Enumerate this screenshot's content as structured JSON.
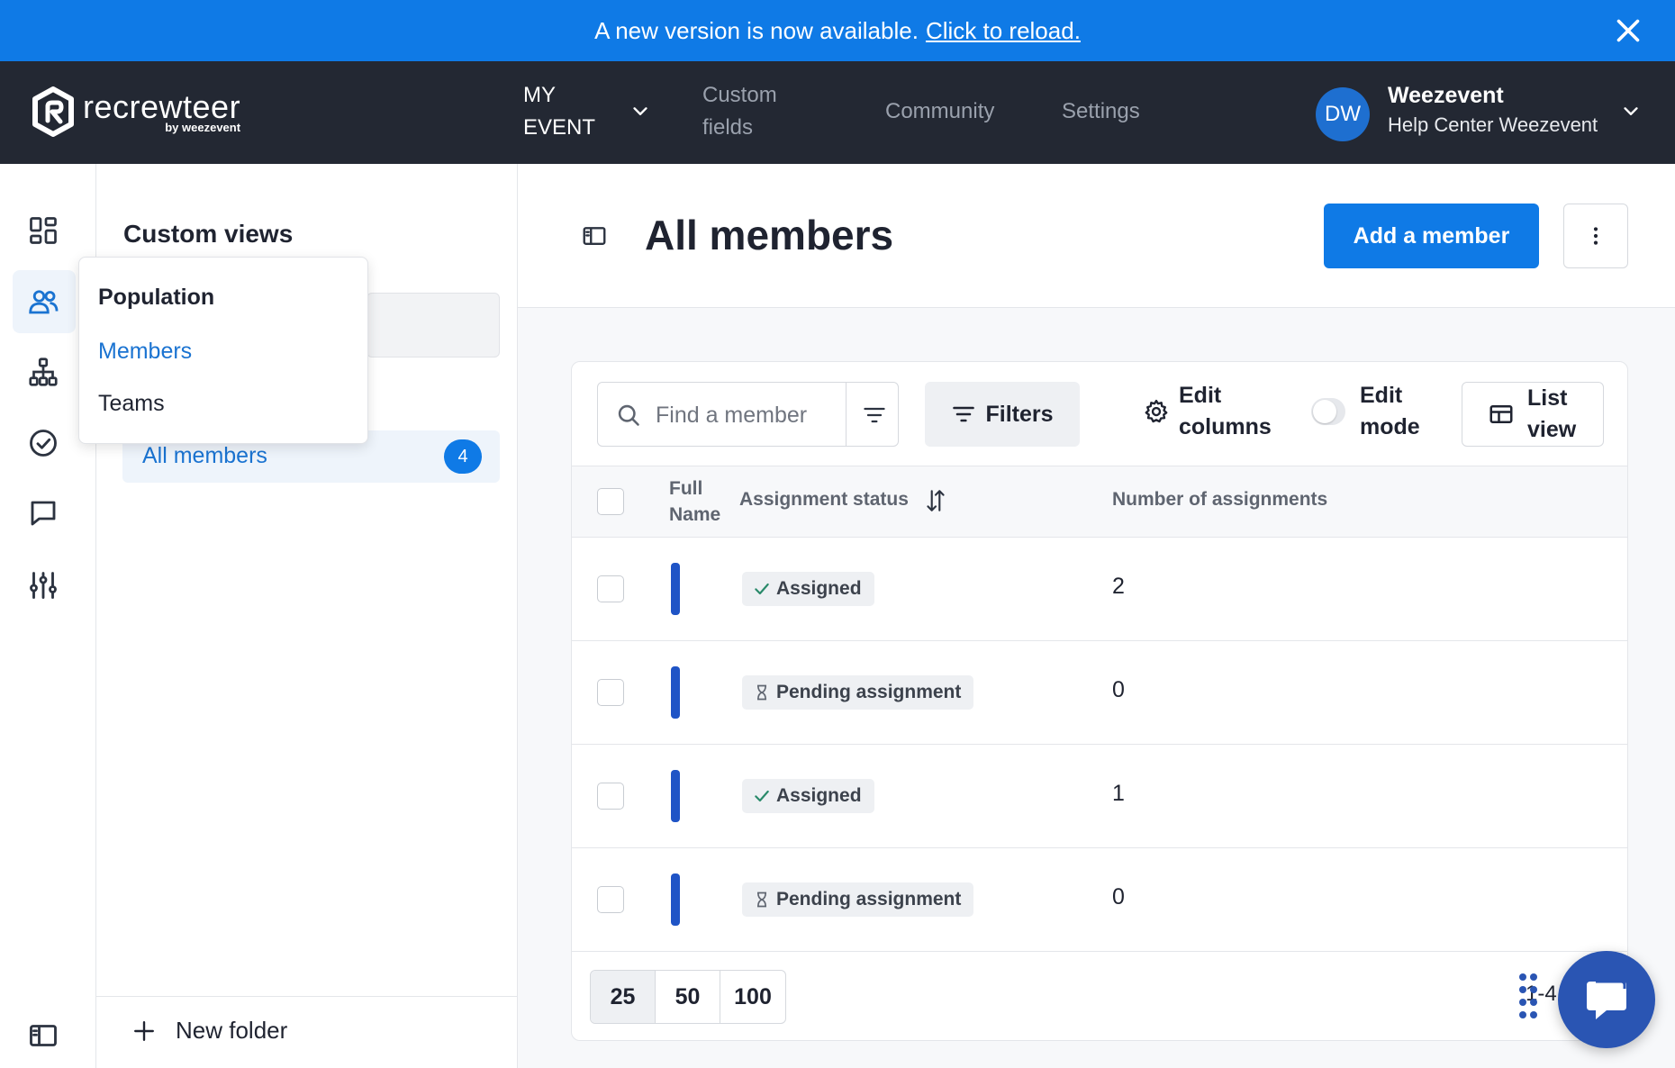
{
  "banner": {
    "message": "A new version is now available.",
    "link_label": "Click to reload."
  },
  "brand": {
    "name": "recrewteer",
    "tagline": "by weezevent",
    "accent_color": "#0f7ae6",
    "nav_bg_color": "#232833"
  },
  "nav": {
    "items": [
      {
        "label": "MY EVENT"
      },
      {
        "label": "Custom fields"
      },
      {
        "label": "Community"
      },
      {
        "label": "Settings"
      }
    ],
    "user": {
      "initials": "DW",
      "name": "Weezevent",
      "org": "Help Center Weezevent"
    }
  },
  "rail": {
    "icons": [
      "dashboard-icon",
      "people-icon",
      "org-chart-icon",
      "check-circle-icon",
      "message-icon",
      "sliders-icon",
      "panel-collapse-icon"
    ]
  },
  "views": {
    "title": "Custom views",
    "items": [
      {
        "label": "All members",
        "count": "4"
      }
    ],
    "new_folder_label": "New folder"
  },
  "popover": {
    "title": "Population",
    "items": [
      {
        "label": "Members"
      },
      {
        "label": "Teams"
      }
    ]
  },
  "main": {
    "title": "All members",
    "add_button_label": "Add a member"
  },
  "toolbar": {
    "search_placeholder": "Find a member",
    "filters_label": "Filters",
    "edit_columns_label": "Edit columns",
    "edit_mode_label": "Edit mode",
    "list_view_label": "List view"
  },
  "table": {
    "columns": [
      "Full Name",
      "Assignment status",
      "Number of assignments"
    ],
    "rows": [
      {
        "status": "Assigned",
        "status_icon": "check-icon",
        "count": "2"
      },
      {
        "status": "Pending assignment",
        "status_icon": "hourglass-icon",
        "count": "0"
      },
      {
        "status": "Assigned",
        "status_icon": "check-icon",
        "count": "1"
      },
      {
        "status": "Pending assignment",
        "status_icon": "hourglass-icon",
        "count": "0"
      }
    ]
  },
  "pagination": {
    "page_sizes": [
      "25",
      "50",
      "100"
    ],
    "selected": "25",
    "range_text": "1-4"
  }
}
